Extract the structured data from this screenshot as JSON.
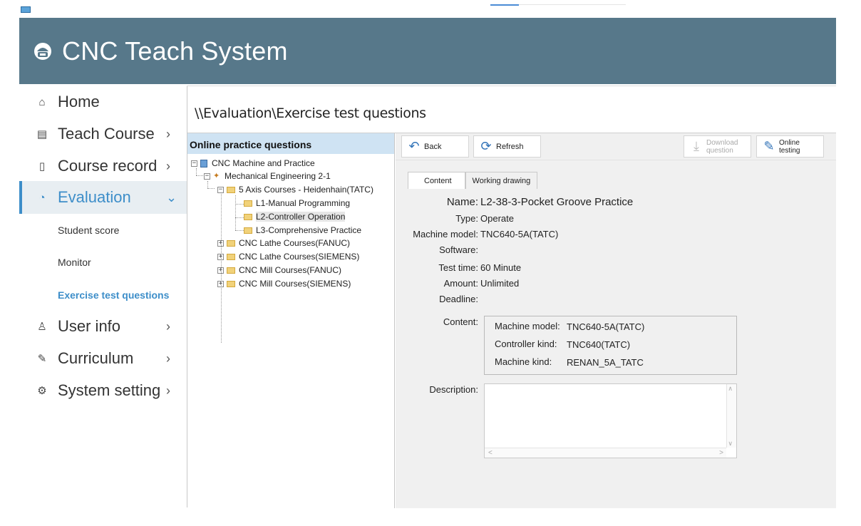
{
  "app": {
    "title": "CNC Teach System"
  },
  "sidebar": {
    "items": [
      {
        "label": "Home",
        "icon": "home-icon"
      },
      {
        "label": "Teach Course",
        "icon": "book-icon"
      },
      {
        "label": "Course record",
        "icon": "document-icon"
      },
      {
        "label": "Evaluation",
        "icon": "pie-chart-icon"
      },
      {
        "label": "User info",
        "icon": "user-icon"
      },
      {
        "label": "Curriculum",
        "icon": "pencil-icon"
      },
      {
        "label": "System setting",
        "icon": "gear-icon"
      }
    ],
    "sub_items": [
      "Student score",
      "Monitor",
      "Exercise test questions"
    ],
    "active_accent": "#3d8ec9"
  },
  "breadcrumb": "\\\\Evaluation\\Exercise test questions",
  "tree": {
    "header": "Online practice questions",
    "nodes": [
      "CNC Machine and Practice",
      "Mechanical Engineering 2-1",
      "5 Axis Courses - Heidenhain(TATC)",
      "L1-Manual Programming",
      "L2-Controller Operation",
      "L3-Comprehensive Practice",
      "CNC Lathe Courses(FANUC)",
      "CNC Lathe Courses(SIEMENS)",
      "CNC Mill Courses(FANUC)",
      "CNC Mill Courses(SIEMENS)"
    ],
    "selected": "L2-Controller Operation"
  },
  "toolbar": {
    "back": "Back",
    "refresh": "Refresh",
    "download_line1": "Download",
    "download_line2": "question",
    "online_line1": "Online",
    "online_line2": "testing"
  },
  "tabs": [
    "Content",
    "Working drawing"
  ],
  "details": {
    "labels": {
      "name": "Name:",
      "type": "Type:",
      "machine_model": "Machine model:",
      "software": "Software:",
      "test_time": "Test time:",
      "amount": "Amount:",
      "deadline": "Deadline:",
      "content": "Content:",
      "description": "Description:"
    },
    "values": {
      "name": "L2-38-3-Pocket Groove Practice",
      "type": "Operate",
      "machine_model": "TNC640-5A(TATC)",
      "software": "",
      "test_time": "60 Minute",
      "amount": "Unlimited",
      "deadline": ""
    },
    "content_box": [
      {
        "key": "Machine model:",
        "value": "TNC640-5A(TATC)"
      },
      {
        "key": "Controller kind:",
        "value": "TNC640(TATC)"
      },
      {
        "key": "Machine kind:",
        "value": "RENAN_5A_TATC"
      }
    ],
    "description": ""
  },
  "colors": {
    "header_bg": "#57788a",
    "tree_header_bg": "#cfe3f3",
    "accent": "#3d8ec9"
  }
}
